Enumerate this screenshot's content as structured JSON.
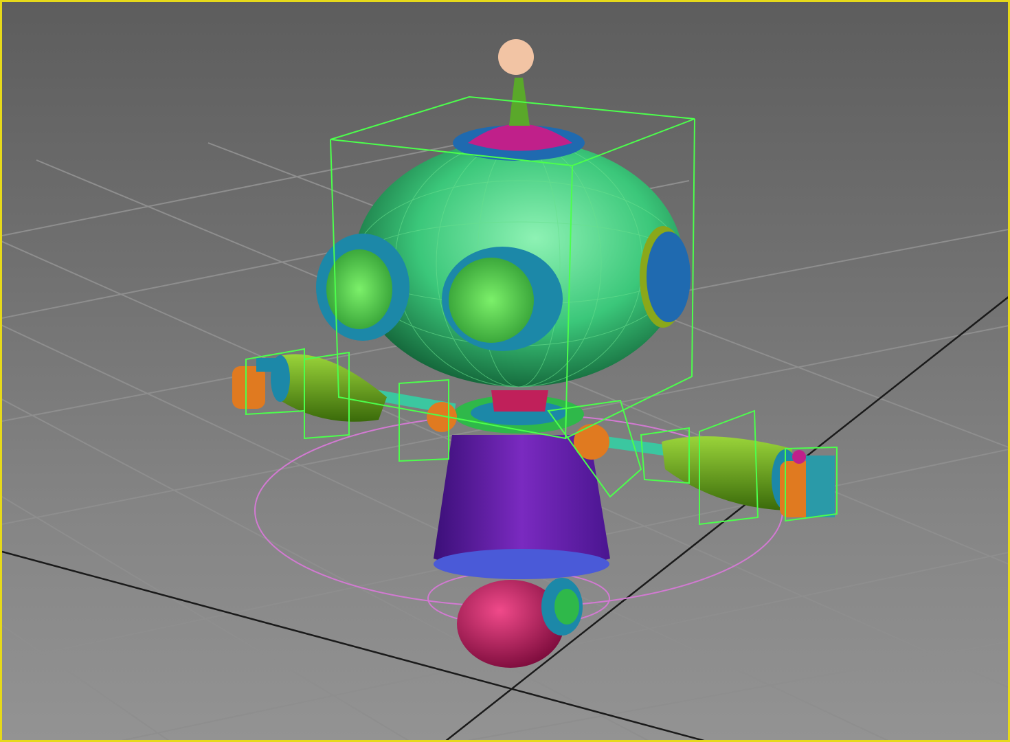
{
  "viewport": {
    "border_color": "#e6d91a",
    "background_top": "#5d5d5d",
    "background_bottom": "#939393",
    "grid_color": "#8e8e8e",
    "grid_axis_color": "#1a1a1a",
    "selection_color": "#4cff4c",
    "helper_color": "#d27ad2"
  },
  "model": {
    "head_color": "#3bc77a",
    "eye_ring_color": "#1c88a8",
    "eye_lens_color": "#5ed44e",
    "top_cap_color": "#c0208a",
    "antenna_color": "#5aa82a",
    "antenna_ball_color": "#f2c4a4",
    "body_color": "#6a1fa8",
    "neck_color": "#c0205a",
    "wheel_color": "#c0205a",
    "arm_color": "#6aaa1a",
    "joint_color": "#e07a20",
    "ear_color": "#1f6ab0"
  }
}
